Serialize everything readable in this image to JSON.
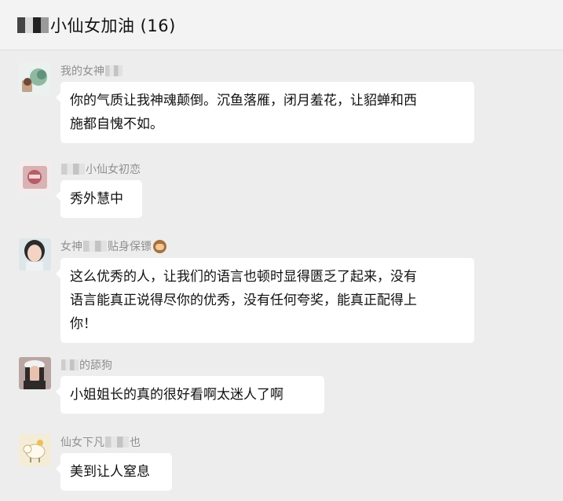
{
  "header": {
    "title": "小仙女加油  (16)"
  },
  "messages": [
    {
      "sender_prefix": "我的女神",
      "sender_suffix": "",
      "text_lines": [
        "你的气质让我神魂颠倒。沉鱼落雁，闭月羞花，让貂蝉和西",
        "施都自愧不如。"
      ]
    },
    {
      "sender_prefix": "",
      "sender_suffix": "小仙女初恋",
      "text_lines": [
        "秀外慧中"
      ]
    },
    {
      "sender_prefix": "女神",
      "sender_suffix": "贴身保镖",
      "text_lines": [
        "这么优秀的人，让我们的语言也顿时显得匮乏了起来，没有",
        "语言能真正说得尽你的优秀，没有任何夸奖，能真正配得上",
        "你！"
      ]
    },
    {
      "sender_prefix": "",
      "sender_suffix": "的舔狗",
      "text_lines": [
        "小姐姐长的真的很好看啊太迷人了啊"
      ]
    },
    {
      "sender_prefix": "仙女下凡",
      "sender_suffix": "也",
      "text_lines": [
        "美到让人窒息"
      ]
    }
  ]
}
